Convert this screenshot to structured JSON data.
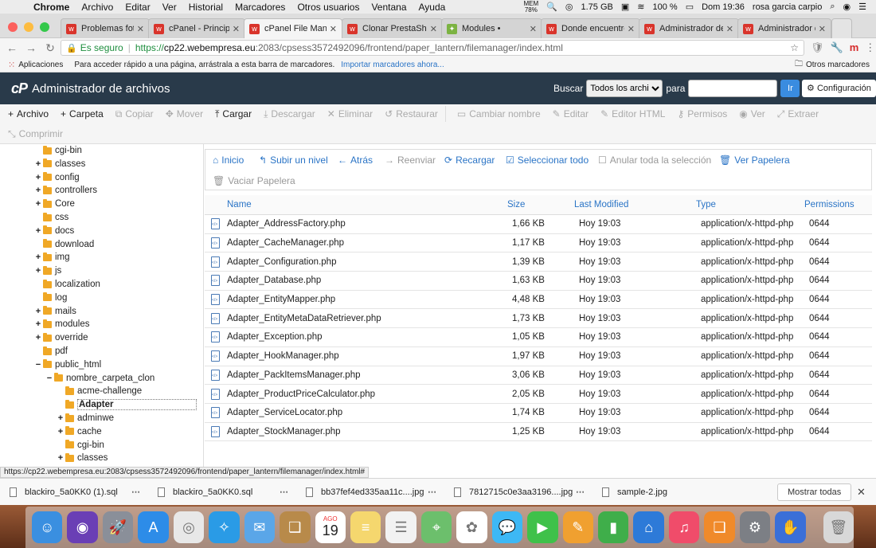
{
  "menubar": {
    "items": [
      "Chrome",
      "Archivo",
      "Editar",
      "Ver",
      "Historial",
      "Marcadores",
      "Otros usuarios",
      "Ventana",
      "Ayuda"
    ],
    "mem_label": "MEM",
    "mem_pct": "78%",
    "disk": "1.75 GB",
    "battery": "100 %",
    "clock": "Dom 19:36",
    "user": "rosa garcia carpio"
  },
  "tabs": [
    {
      "title": "Problemas fotos c",
      "color": "#d9342b",
      "fav": "w"
    },
    {
      "title": "cPanel - Principal",
      "color": "#d9342b",
      "fav": "w"
    },
    {
      "title": "cPanel File Manag",
      "color": "#d9342b",
      "fav": "w",
      "active": true
    },
    {
      "title": "Clonar PrestaShop",
      "color": "#d9342b",
      "fav": "w"
    },
    {
      "title": "Modules •",
      "color": "#7cb342",
      "fav": "✦"
    },
    {
      "title": "Donde encuentro",
      "color": "#d9342b",
      "fav": "w"
    },
    {
      "title": "Administrador de",
      "color": "#d9342b",
      "fav": "w"
    },
    {
      "title": "Administrador de",
      "color": "#d9342b",
      "fav": "w"
    }
  ],
  "address": {
    "secure_label": "Es seguro",
    "url_scheme": "https://",
    "url_host": "cp22.webempresa.eu",
    "url_rest": ":2083/cpsess3572492096/frontend/paper_lantern/filemanager/index.html"
  },
  "bookmarks": {
    "apps": "Aplicaciones",
    "hint": "Para acceder rápido a una página, arrástrala a esta barra de marcadores.",
    "import": "Importar marcadores ahora...",
    "others": "Otros marcadores"
  },
  "cpanel": {
    "logo": "cP",
    "title": "Administrador de archivos",
    "search_label": "Buscar",
    "search_select": "Todos los archivos",
    "search_for": "para",
    "go": "Ir",
    "settings": "Configuración"
  },
  "toolbar": {
    "row1": [
      {
        "label": "Archivo",
        "icon": "+",
        "on": true
      },
      {
        "label": "Carpeta",
        "icon": "+",
        "on": true
      },
      {
        "label": "Copiar",
        "icon": "⧉",
        "on": false
      },
      {
        "label": "Mover",
        "icon": "✥",
        "on": false
      },
      {
        "label": "Cargar",
        "icon": "⤒",
        "on": true
      },
      {
        "label": "Descargar",
        "icon": "⤓",
        "on": false
      },
      {
        "label": "Eliminar",
        "icon": "✕",
        "on": false
      },
      {
        "label": "Restaurar",
        "icon": "↺",
        "on": false
      },
      {
        "label": "Cambiar nombre",
        "icon": "▭",
        "on": false
      },
      {
        "label": "Editar",
        "icon": "✎",
        "on": false
      },
      {
        "label": "Editor HTML",
        "icon": "✎",
        "on": false
      },
      {
        "label": "Permisos",
        "icon": "⚷",
        "on": false
      },
      {
        "label": "Ver",
        "icon": "◉",
        "on": false
      },
      {
        "label": "Extraer",
        "icon": "⤢",
        "on": false
      }
    ],
    "row2": [
      {
        "label": "Comprimir",
        "icon": "⤡",
        "on": false
      }
    ]
  },
  "tree": [
    {
      "label": "cgi-bin",
      "level": 0,
      "pm": ""
    },
    {
      "label": "classes",
      "level": 0,
      "pm": "+"
    },
    {
      "label": "config",
      "level": 0,
      "pm": "+"
    },
    {
      "label": "controllers",
      "level": 0,
      "pm": "+"
    },
    {
      "label": "Core",
      "level": 0,
      "pm": "+"
    },
    {
      "label": "css",
      "level": 0,
      "pm": ""
    },
    {
      "label": "docs",
      "level": 0,
      "pm": "+"
    },
    {
      "label": "download",
      "level": 0,
      "pm": ""
    },
    {
      "label": "img",
      "level": 0,
      "pm": "+"
    },
    {
      "label": "js",
      "level": 0,
      "pm": "+"
    },
    {
      "label": "localization",
      "level": 0,
      "pm": ""
    },
    {
      "label": "log",
      "level": 0,
      "pm": ""
    },
    {
      "label": "mails",
      "level": 0,
      "pm": "+"
    },
    {
      "label": "modules",
      "level": 0,
      "pm": "+"
    },
    {
      "label": "override",
      "level": 0,
      "pm": "+"
    },
    {
      "label": "pdf",
      "level": 0,
      "pm": ""
    },
    {
      "label": "public_html",
      "level": 0,
      "pm": "−"
    },
    {
      "label": "nombre_carpeta_clon",
      "level": 1,
      "pm": "−"
    },
    {
      "label": "acme-challenge",
      "level": 2,
      "pm": ""
    },
    {
      "label": "Adapter",
      "level": 2,
      "pm": "",
      "selected": true
    },
    {
      "label": "adminwe",
      "level": 2,
      "pm": "+"
    },
    {
      "label": "cache",
      "level": 2,
      "pm": "+"
    },
    {
      "label": "cgi-bin",
      "level": 2,
      "pm": ""
    },
    {
      "label": "classes",
      "level": 2,
      "pm": "+"
    }
  ],
  "actions": {
    "row1": [
      {
        "label": "Inicio",
        "icon": "⌂",
        "dis": false
      },
      {
        "label": "Subir un nivel",
        "icon": "↰",
        "dis": false
      },
      {
        "label": "Atrás",
        "icon": "←",
        "dis": false
      },
      {
        "label": "Reenviar",
        "icon": "→",
        "dis": true
      },
      {
        "label": "Recargar",
        "icon": "⟳",
        "dis": false
      },
      {
        "label": "Seleccionar todo",
        "icon": "☑",
        "dis": false
      },
      {
        "label": "Anular toda la selección",
        "icon": "☐",
        "dis": true
      },
      {
        "label": "Ver Papelera",
        "icon": "🗑",
        "dis": false
      }
    ],
    "row2": [
      {
        "label": "Vaciar Papelera",
        "icon": "🗑",
        "dis": true
      }
    ]
  },
  "table": {
    "headers": {
      "name": "Name",
      "size": "Size",
      "modified": "Last Modified",
      "type": "Type",
      "perms": "Permissions"
    },
    "rows": [
      {
        "name": "Adapter_AddressFactory.php",
        "size": "1,66 KB",
        "modified": "Hoy 19:03",
        "type": "application/x-httpd-php",
        "perms": "0644"
      },
      {
        "name": "Adapter_CacheManager.php",
        "size": "1,17 KB",
        "modified": "Hoy 19:03",
        "type": "application/x-httpd-php",
        "perms": "0644"
      },
      {
        "name": "Adapter_Configuration.php",
        "size": "1,39 KB",
        "modified": "Hoy 19:03",
        "type": "application/x-httpd-php",
        "perms": "0644"
      },
      {
        "name": "Adapter_Database.php",
        "size": "1,63 KB",
        "modified": "Hoy 19:03",
        "type": "application/x-httpd-php",
        "perms": "0644"
      },
      {
        "name": "Adapter_EntityMapper.php",
        "size": "4,48 KB",
        "modified": "Hoy 19:03",
        "type": "application/x-httpd-php",
        "perms": "0644"
      },
      {
        "name": "Adapter_EntityMetaDataRetriever.php",
        "size": "1,73 KB",
        "modified": "Hoy 19:03",
        "type": "application/x-httpd-php",
        "perms": "0644"
      },
      {
        "name": "Adapter_Exception.php",
        "size": "1,05 KB",
        "modified": "Hoy 19:03",
        "type": "application/x-httpd-php",
        "perms": "0644"
      },
      {
        "name": "Adapter_HookManager.php",
        "size": "1,97 KB",
        "modified": "Hoy 19:03",
        "type": "application/x-httpd-php",
        "perms": "0644"
      },
      {
        "name": "Adapter_PackItemsManager.php",
        "size": "3,06 KB",
        "modified": "Hoy 19:03",
        "type": "application/x-httpd-php",
        "perms": "0644"
      },
      {
        "name": "Adapter_ProductPriceCalculator.php",
        "size": "2,05 KB",
        "modified": "Hoy 19:03",
        "type": "application/x-httpd-php",
        "perms": "0644"
      },
      {
        "name": "Adapter_ServiceLocator.php",
        "size": "1,74 KB",
        "modified": "Hoy 19:03",
        "type": "application/x-httpd-php",
        "perms": "0644"
      },
      {
        "name": "Adapter_StockManager.php",
        "size": "1,25 KB",
        "modified": "Hoy 19:03",
        "type": "application/x-httpd-php",
        "perms": "0644"
      }
    ]
  },
  "status_url": "https://cp22.webempresa.eu:2083/cpsess3572492096/frontend/paper_lantern/filemanager/index.html#",
  "downloads": {
    "items": [
      "blackiro_5a0KK0 (1).sql",
      "blackiro_5a0KK0.sql",
      "bb37fef4ed335aa11c....jpg",
      "7812715c0e3aa3196....jpg",
      "sample-2.jpg"
    ],
    "show_all": "Mostrar todas"
  },
  "dock": {
    "calendar_month": "AGO",
    "calendar_day": "19",
    "apps": [
      {
        "name": "finder-icon",
        "color": "#3a8fe0",
        "glyph": "☺"
      },
      {
        "name": "siri-icon",
        "color": "#6a3fb5",
        "glyph": "◉"
      },
      {
        "name": "launchpad-icon",
        "color": "#8a8f99",
        "glyph": "🚀"
      },
      {
        "name": "app-store-icon",
        "color": "#2d8ce8",
        "glyph": "A"
      },
      {
        "name": "chrome-icon",
        "color": "#e8e8e8",
        "glyph": "◎"
      },
      {
        "name": "safari-icon",
        "color": "#2a9be6",
        "glyph": "✧"
      },
      {
        "name": "mail-icon",
        "color": "#5aa6e8",
        "glyph": "✉"
      },
      {
        "name": "notes-book-icon",
        "color": "#b88a4a",
        "glyph": "❑"
      },
      {
        "name": "calendar-icon",
        "color": "#ffffff",
        "glyph": "19"
      },
      {
        "name": "notes-icon",
        "color": "#f5d76e",
        "glyph": "≡"
      },
      {
        "name": "reminders-icon",
        "color": "#f2f2f2",
        "glyph": "☰"
      },
      {
        "name": "maps-icon",
        "color": "#6cbf6c",
        "glyph": "⌖"
      },
      {
        "name": "photos-icon",
        "color": "#ffffff",
        "glyph": "✿"
      },
      {
        "name": "messages-icon",
        "color": "#3db8f5",
        "glyph": "💬"
      },
      {
        "name": "facetime-icon",
        "color": "#3fc14a",
        "glyph": "▶"
      },
      {
        "name": "pages-icon",
        "color": "#f0a030",
        "glyph": "✎"
      },
      {
        "name": "numbers-icon",
        "color": "#3fae4a",
        "glyph": "▮"
      },
      {
        "name": "keynote-icon",
        "color": "#2d7ad8",
        "glyph": "⌂"
      },
      {
        "name": "music-icon",
        "color": "#f04c6a",
        "glyph": "♫"
      },
      {
        "name": "books-icon",
        "color": "#f08a2a",
        "glyph": "❏"
      },
      {
        "name": "system-preferences-icon",
        "color": "#7c7f85",
        "glyph": "⚙"
      },
      {
        "name": "preview-icon",
        "color": "#3a6fd8",
        "glyph": "✋"
      },
      {
        "name": "trash-icon",
        "color": "#d8d8d8",
        "glyph": "🗑"
      }
    ]
  }
}
